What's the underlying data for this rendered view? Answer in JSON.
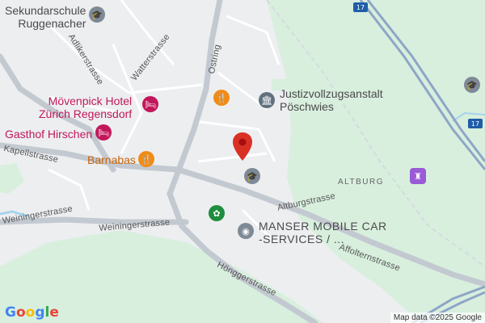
{
  "map": {
    "colors": {
      "land": "#eceef0",
      "green": "#d8efde",
      "road_major": "#c3c9d0",
      "highway": "#8ea6c6",
      "water": "#a5d3eb",
      "pin": "#d93025",
      "poi_red": "#c2185b",
      "poi_orange": "#c8650a",
      "poi_grey": "#60707f"
    },
    "pois": [
      {
        "label": "Sekundarschule\nRuggenacher",
        "icon": "school-icon",
        "category": "school"
      },
      {
        "label": "Mövenpick Hotel\nZürich Regensdorf",
        "icon": "hotel-icon",
        "category": "hotel"
      },
      {
        "label": "Gasthof Hirschen",
        "icon": "hotel-icon",
        "category": "hotel"
      },
      {
        "label": "Barnabas",
        "icon": "restaurant-icon",
        "category": "restaurant"
      },
      {
        "label": "Justizvollzugsanstalt\nPöschwies",
        "icon": "government-icon",
        "category": "government"
      },
      {
        "label": "MANSER MOBILE CAR\n-SERVICES / ...",
        "icon": "place-icon",
        "category": "business"
      }
    ],
    "streets": [
      "Adlikerstrasse",
      "Watterstrasse",
      "Ostring",
      "Kapellstrasse",
      "Weiningerstrasse",
      "Weiningerstrasse",
      "Altburgstrasse",
      "Affolternstrasse",
      "Hönggerstrasse"
    ],
    "areas": [
      "ALTBURG"
    ],
    "route_shields": [
      "17",
      "17"
    ],
    "logo": "Google",
    "attribution": "Map data ©2025 Google"
  }
}
